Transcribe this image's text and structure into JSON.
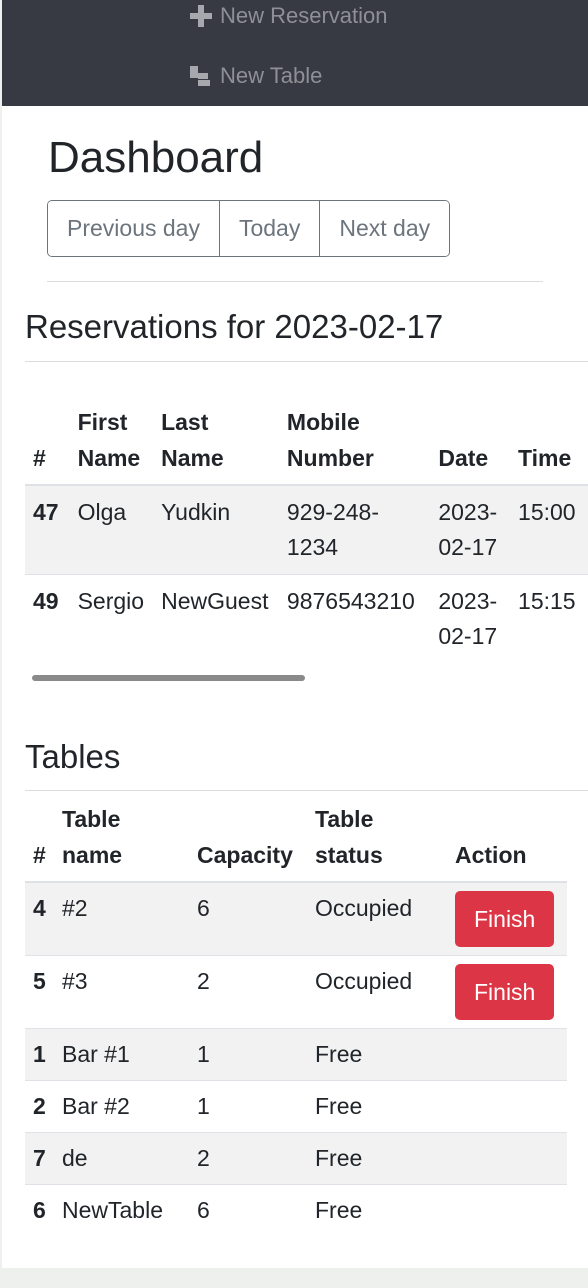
{
  "nav": {
    "new_reservation": "New Reservation",
    "new_table": "New Table"
  },
  "dashboard": {
    "title": "Dashboard",
    "buttons": {
      "previous": "Previous day",
      "today": "Today",
      "next": "Next day"
    }
  },
  "reservations": {
    "heading": "Reservations for 2023-02-17",
    "columns": [
      "#",
      "First Name",
      "Last Name",
      "Mobile Number",
      "Date",
      "Time"
    ],
    "rows": [
      {
        "id": "47",
        "first": "Olga",
        "last": "Yudkin",
        "mobile": "929-248-1234",
        "date": "2023-02-17",
        "time": "15:00"
      },
      {
        "id": "49",
        "first": "Sergio",
        "last": "NewGuest",
        "mobile": "9876543210",
        "date": "2023-02-17",
        "time": "15:15"
      }
    ]
  },
  "tables": {
    "heading": "Tables",
    "columns": [
      "#",
      "Table name",
      "Capacity",
      "Table status",
      "Action"
    ],
    "finish_label": "Finish",
    "rows": [
      {
        "id": "4",
        "name": "#2",
        "capacity": "6",
        "status": "Occupied",
        "finish": true
      },
      {
        "id": "5",
        "name": "#3",
        "capacity": "2",
        "status": "Occupied",
        "finish": true
      },
      {
        "id": "1",
        "name": "Bar #1",
        "capacity": "1",
        "status": "Free",
        "finish": false
      },
      {
        "id": "2",
        "name": "Bar #2",
        "capacity": "1",
        "status": "Free",
        "finish": false
      },
      {
        "id": "7",
        "name": "de",
        "capacity": "2",
        "status": "Free",
        "finish": false
      },
      {
        "id": "6",
        "name": "NewTable",
        "capacity": "6",
        "status": "Free",
        "finish": false
      }
    ]
  },
  "colors": {
    "nav_bg": "#373a43",
    "danger": "#dc3545",
    "secondary": "#6c757d"
  }
}
